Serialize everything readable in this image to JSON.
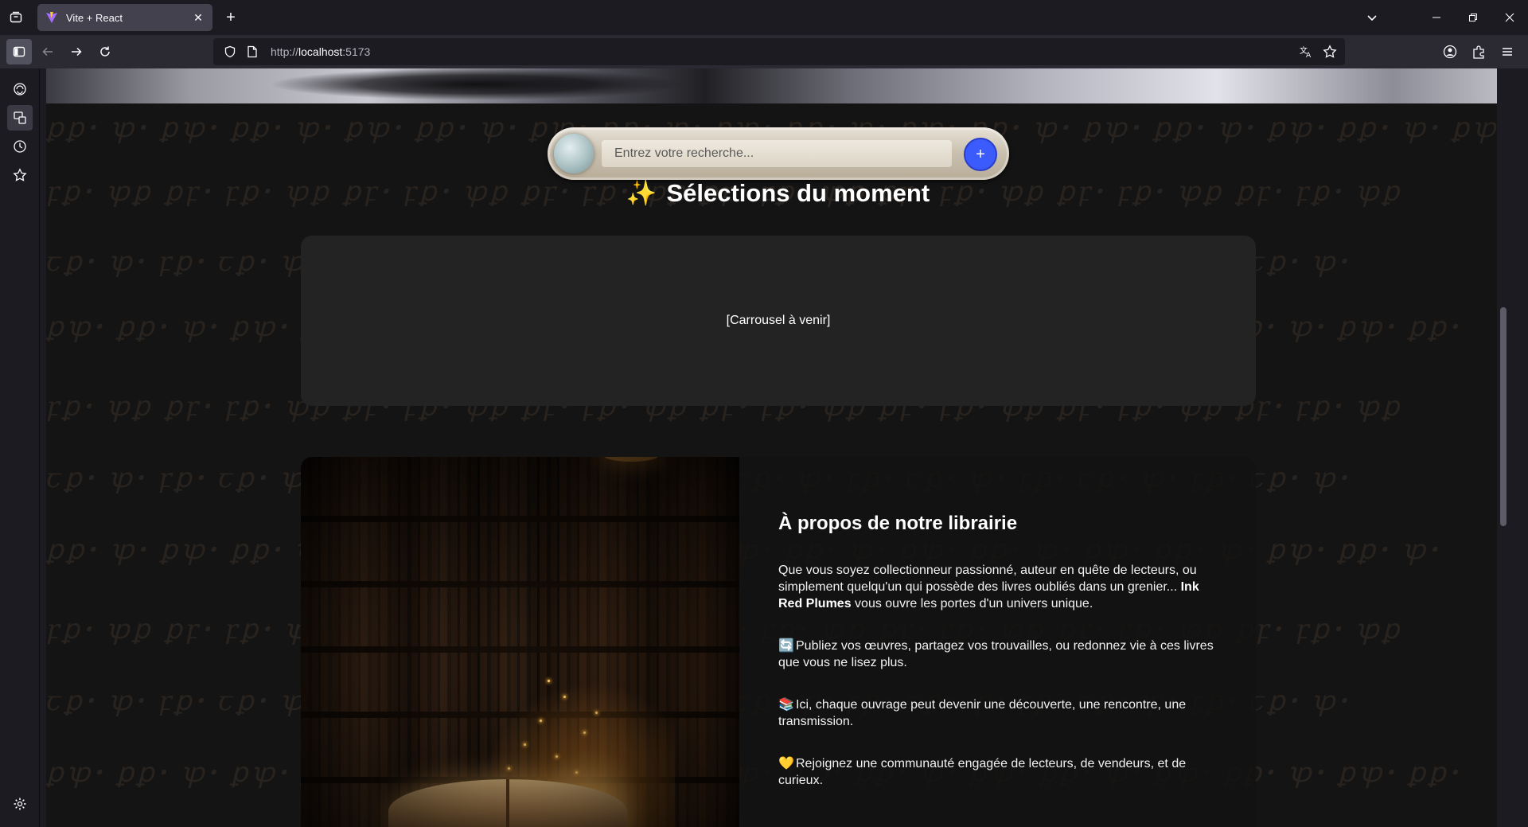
{
  "browser": {
    "tab_title": "Vite + React",
    "url_host": "localhost",
    "url_prefix": "http://",
    "url_port": ":5173"
  },
  "search": {
    "placeholder": "Entrez votre recherche...",
    "button_label": "+"
  },
  "selections": {
    "sparkle": "✨",
    "title": "Sélections du moment",
    "carousel_placeholder": "[Carrousel à venir]"
  },
  "about": {
    "title": "À propos de notre librairie",
    "intro_before": "Que vous soyez collectionneur passionné, auteur en quête de lecteurs, ou simplement quelqu'un qui possède des livres oubliés dans un grenier... ",
    "brand": "Ink Red Plumes",
    "intro_after": " vous ouvre les portes d'un univers unique.",
    "point1_emoji": "🔄",
    "point1": "Publiez vos œuvres, partagez vos trouvailles, ou redonnez vie à ces livres que vous ne lisez plus.",
    "point2_emoji": "📚",
    "point2": "Ici, chaque ouvrage peut devenir une découverte, une rencontre, une transmission.",
    "point3_emoji": "💛",
    "point3": "Rejoignez une communauté engagée de lecteurs, de vendeurs, et de curieux."
  },
  "colors": {
    "accent_button": "#3b5bfd",
    "page_bg": "#141414",
    "card_bg": "#232323"
  },
  "icons": [
    "tab-list-icon",
    "vite-favicon",
    "close-icon",
    "plus-icon",
    "chevron-down-icon",
    "minimize-icon",
    "restore-icon",
    "sidebar-icon",
    "back-arrow-icon",
    "forward-arrow-icon",
    "reload-icon",
    "shield-icon",
    "page-icon",
    "translate-icon",
    "star-icon",
    "account-icon",
    "extensions-icon",
    "menu-icon",
    "ai-chatbot-icon",
    "synced-tabs-icon",
    "history-icon",
    "bookmarks-icon",
    "settings-icon"
  ]
}
